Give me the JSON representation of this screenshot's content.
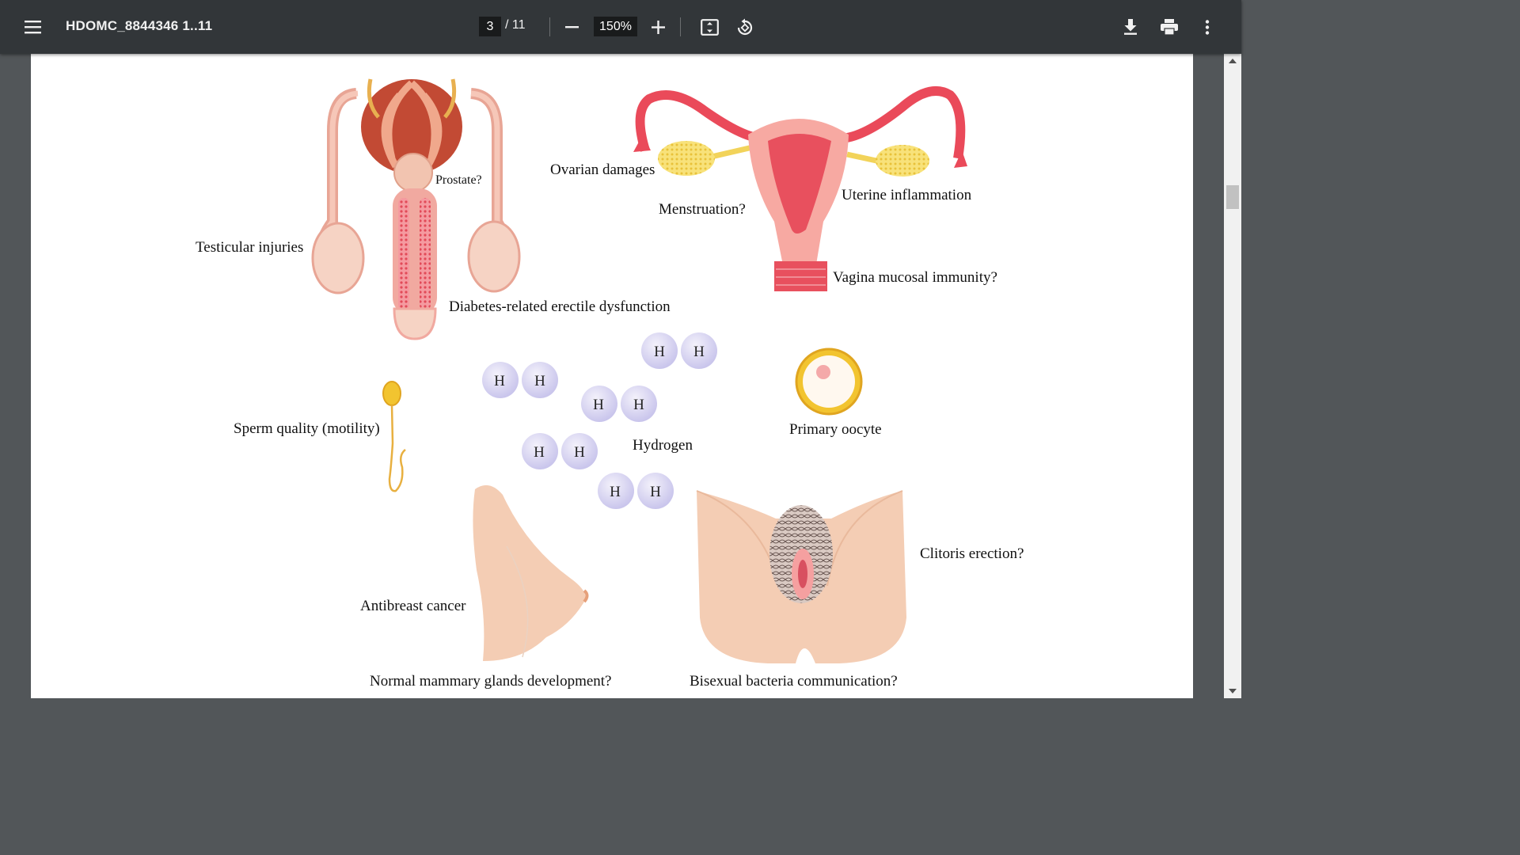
{
  "toolbar": {
    "title": "HDOMC_8844346 1..11",
    "page_current": "3",
    "page_total": "/ 11",
    "zoom": "150%",
    "icons": [
      "menu-icon",
      "zoom-out-icon",
      "zoom-in-icon",
      "fit-page-icon",
      "rotate-icon",
      "download-icon",
      "print-icon",
      "more-vert-icon"
    ]
  },
  "figure": {
    "labels": {
      "prostate": "Prostate?",
      "testicular": "Testicular injuries",
      "erectile": "Diabetes-related erectile dysfunction",
      "ovarian": "Ovarian damages",
      "menstruation": "Menstruation?",
      "uterine": "Uterine inflammation",
      "vagina": "Vagina mucosal immunity?",
      "sperm": "Sperm quality (motility)",
      "hydrogen": "Hydrogen",
      "oocyte": "Primary oocyte",
      "antibreast": "Antibreast cancer",
      "mammary": "Normal mammary glands development?",
      "clitoris": "Clitoris erection?",
      "bisexual": "Bisexual bacteria communication?"
    },
    "atom_symbol": "H"
  }
}
